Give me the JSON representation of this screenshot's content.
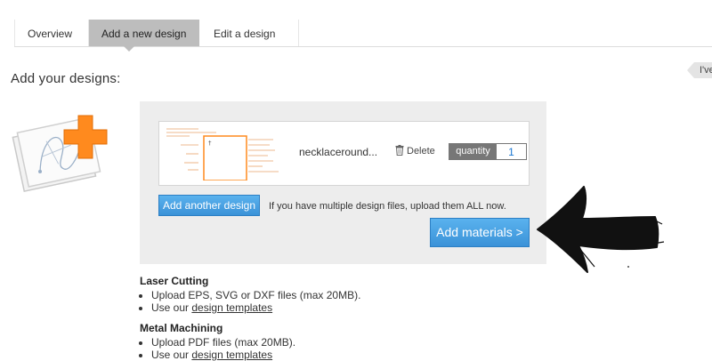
{
  "tabs": [
    {
      "label": "Overview"
    },
    {
      "label": "Add a new design"
    },
    {
      "label": "Edit a design"
    }
  ],
  "side_tag": "I've",
  "heading": "Add your designs:",
  "upload": {
    "file_name": "necklaceround...",
    "delete_label": "Delete",
    "quantity_label": "quantity",
    "quantity_value": "1"
  },
  "actions": {
    "add_another_label": "Add another design",
    "hint": "If you have multiple design files, upload them ALL now.",
    "add_materials_label": "Add materials >"
  },
  "sections": [
    {
      "title": "Laser Cutting",
      "items": [
        "Upload EPS, SVG or DXF files (max 20MB).",
        "Use our",
        "design templates"
      ]
    },
    {
      "title": "Metal Machining",
      "items": [
        "Upload PDF files (max 20MB).",
        "Use our",
        "design templates"
      ]
    }
  ],
  "colors": {
    "accent": "#3b92d8",
    "orange": "#ff8a1e",
    "panel": "#ededed"
  }
}
